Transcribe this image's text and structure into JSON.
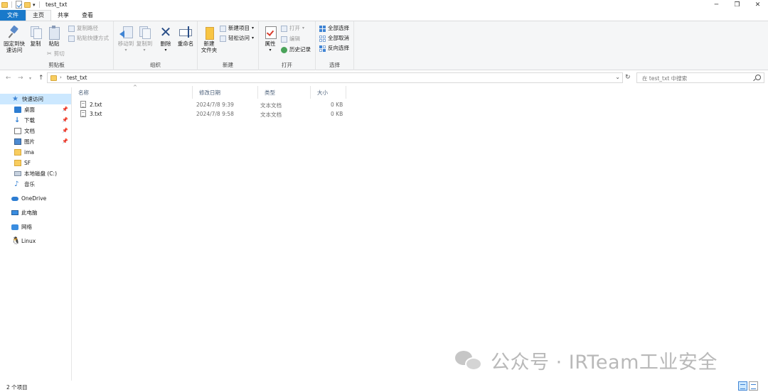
{
  "window": {
    "title": "test_txt",
    "controls": {
      "minimize": "─",
      "maximize": "❐",
      "close": "✕"
    }
  },
  "tabs": [
    {
      "label": "文件"
    },
    {
      "label": "主页"
    },
    {
      "label": "共享"
    },
    {
      "label": "查看"
    }
  ],
  "ribbon": {
    "clipboard": {
      "group_label": "剪贴板",
      "pin": "固定到快\n速访问",
      "copy": "复制",
      "paste": "粘贴",
      "copy_path": "复制路径",
      "paste_shortcut": "粘贴快捷方式",
      "cut": "剪切"
    },
    "organize": {
      "group_label": "组织",
      "move_to": "移动到",
      "copy_to": "复制到",
      "delete": "删除",
      "rename": "重命名"
    },
    "new": {
      "group_label": "新建",
      "new_folder": "新建\n文件夹",
      "new_item": "新建项目",
      "easy_access": "轻松访问"
    },
    "open": {
      "group_label": "打开",
      "properties": "属性",
      "open": "打开",
      "edit": "编辑",
      "history": "历史记录"
    },
    "select": {
      "group_label": "选择",
      "select_all": "全部选择",
      "select_none": "全部取消",
      "invert": "反向选择"
    }
  },
  "address": {
    "path": "test_txt",
    "search_placeholder": "在 test_txt 中搜索"
  },
  "nav_pane": {
    "quick_access": "快速访问",
    "items": [
      {
        "label": "桌面",
        "icon": "desktop-icon",
        "pinned": true
      },
      {
        "label": "下载",
        "icon": "download-icon",
        "pinned": true
      },
      {
        "label": "文档",
        "icon": "document-icon",
        "pinned": true
      },
      {
        "label": "图片",
        "icon": "picture-icon",
        "pinned": true
      },
      {
        "label": "ima",
        "icon": "folder-icon",
        "pinned": false
      },
      {
        "label": "SF",
        "icon": "folder-icon",
        "pinned": false
      },
      {
        "label": "本地磁盘 (C:)",
        "icon": "drive-icon",
        "pinned": false
      },
      {
        "label": "音乐",
        "icon": "music-icon",
        "pinned": false
      }
    ],
    "onedrive": "OneDrive",
    "this_pc": "此电脑",
    "network": "网络",
    "linux": "Linux"
  },
  "columns": {
    "name": "名称",
    "modified": "修改日期",
    "type": "类型",
    "size": "大小"
  },
  "files": [
    {
      "name": "2.txt",
      "modified": "2024/7/8 9:39",
      "type": "文本文档",
      "size": "0 KB"
    },
    {
      "name": "3.txt",
      "modified": "2024/7/8 9:58",
      "type": "文本文档",
      "size": "0 KB"
    }
  ],
  "status": {
    "count": "2 个项目"
  },
  "watermark": "公众号 · IRTeam工业安全"
}
